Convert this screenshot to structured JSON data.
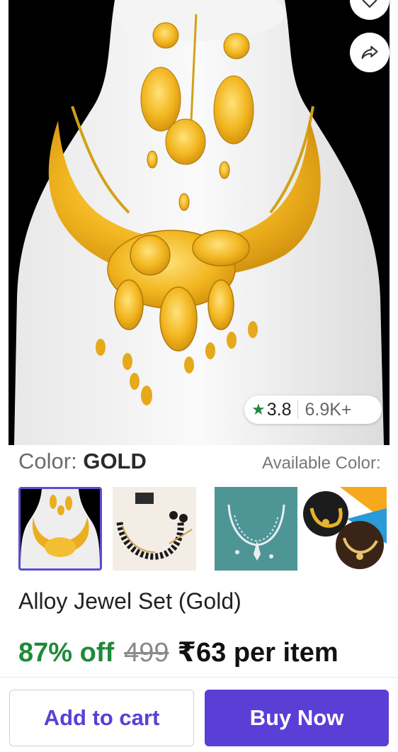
{
  "product": {
    "rating": {
      "value": "3.8",
      "count": "6.9K+",
      "star_color": "#1f8a3a"
    },
    "color": {
      "label": "Color:",
      "value": "GOLD",
      "available_label": "Available Color:"
    },
    "swatches": [
      {
        "name": "gold-necklace-set",
        "selected": true
      },
      {
        "name": "black-stone-necklace-set",
        "selected": false
      },
      {
        "name": "silver-necklace-set",
        "selected": false
      },
      {
        "name": "gold-and-kundan-sets",
        "selected": false
      }
    ],
    "title": "Alloy Jewel Set (Gold)",
    "price": {
      "discount": "87% off",
      "mrp": "499",
      "selling": "₹63 per item"
    }
  },
  "actions": {
    "add_to_cart": "Add to cart",
    "buy_now": "Buy Now"
  },
  "theme": {
    "accent": "#5a3fd6",
    "discount_green": "#1f8a3a"
  },
  "icons": {
    "wishlist": "heart-icon",
    "share": "share-arrow-icon",
    "rating": "star-icon"
  }
}
